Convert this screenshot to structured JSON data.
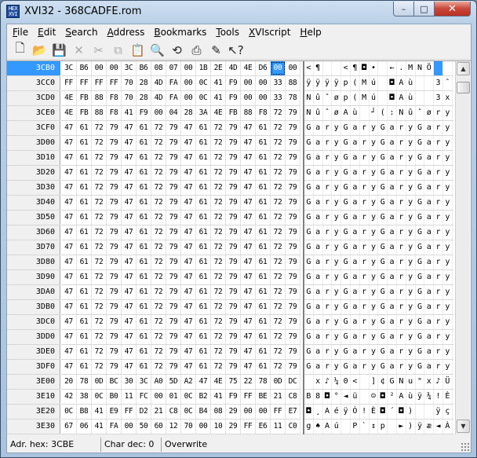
{
  "window": {
    "title": "XVI32 - 368CADFE.rom",
    "icon": "app-hex-icon"
  },
  "controls": {
    "minimize": "–",
    "maximize": "□",
    "close": "✕"
  },
  "menu": [
    {
      "label": "File",
      "u": "F",
      "rest": "ile"
    },
    {
      "label": "Edit",
      "u": "E",
      "rest": "dit"
    },
    {
      "label": "Search",
      "u": "S",
      "rest": "earch"
    },
    {
      "label": "Address",
      "u": "A",
      "rest": "ddress"
    },
    {
      "label": "Bookmarks",
      "u": "B",
      "rest": "ookmarks"
    },
    {
      "label": "Tools",
      "u": "T",
      "rest": "ools"
    },
    {
      "label": "XVIscript",
      "u": "X",
      "rest": "VIscript"
    },
    {
      "label": "Help",
      "u": "H",
      "rest": "elp"
    }
  ],
  "toolbar": [
    {
      "name": "new-file-icon",
      "glyph": "🗋",
      "dim": false
    },
    {
      "name": "open-folder-icon",
      "glyph": "📂",
      "dim": false
    },
    {
      "name": "save-disk-icon",
      "glyph": "💾",
      "dim": false
    },
    {
      "name": "delete-x-icon",
      "glyph": "✕",
      "dim": true
    },
    {
      "name": "cut-scissors-icon",
      "glyph": "✂",
      "dim": true
    },
    {
      "name": "copy-icon",
      "glyph": "⧉",
      "dim": true
    },
    {
      "name": "paste-clipboard-icon",
      "glyph": "📋",
      "dim": false
    },
    {
      "name": "find-magnifier-icon",
      "glyph": "🔍",
      "dim": false
    },
    {
      "name": "replace-icon",
      "glyph": "⟲",
      "dim": false
    },
    {
      "name": "print-icon",
      "glyph": "⎙",
      "dim": false
    },
    {
      "name": "script-pen-icon",
      "glyph": "✎",
      "dim": false
    },
    {
      "name": "context-help-icon",
      "glyph": "↖?",
      "dim": false
    }
  ],
  "selection": {
    "row": 0,
    "col": 14
  },
  "rows": [
    {
      "addr": "3CB0",
      "hex": [
        "3C",
        "B6",
        "00",
        "00",
        "3C",
        "B6",
        "08",
        "07",
        "00",
        "1B",
        "2E",
        "4D",
        "4E",
        "D6",
        "00",
        "00"
      ],
      "text": [
        "<",
        "¶",
        " ",
        " ",
        "<",
        "¶",
        "◘",
        "•",
        " ",
        "←",
        ".",
        "M",
        "N",
        "Ö",
        " ",
        " "
      ]
    },
    {
      "addr": "3CC0",
      "hex": [
        "FF",
        "FF",
        "FF",
        "FF",
        "70",
        "28",
        "4D",
        "FA",
        "00",
        "0C",
        "41",
        "F9",
        "00",
        "00",
        "33",
        "88"
      ],
      "text": [
        "ÿ",
        "ÿ",
        "ÿ",
        "ÿ",
        "p",
        "(",
        "M",
        "ú",
        " ",
        "◘",
        "A",
        "ù",
        " ",
        " ",
        "3",
        "ˆ"
      ]
    },
    {
      "addr": "3CD0",
      "hex": [
        "4E",
        "FB",
        "88",
        "F8",
        "70",
        "28",
        "4D",
        "FA",
        "00",
        "0C",
        "41",
        "F9",
        "00",
        "00",
        "33",
        "78"
      ],
      "text": [
        "N",
        "û",
        "ˆ",
        "ø",
        "p",
        "(",
        "M",
        "ú",
        " ",
        "◘",
        "A",
        "ù",
        " ",
        " ",
        "3",
        "x"
      ]
    },
    {
      "addr": "3CE0",
      "hex": [
        "4E",
        "FB",
        "88",
        "F8",
        "41",
        "F9",
        "00",
        "04",
        "28",
        "3A",
        "4E",
        "FB",
        "88",
        "F8",
        "72",
        "79"
      ],
      "text": [
        "N",
        "û",
        "ˆ",
        "ø",
        "A",
        "ù",
        " ",
        "┘",
        "(",
        ":",
        "N",
        "û",
        "ˆ",
        "ø",
        "r",
        "y"
      ]
    },
    {
      "addr": "3CF0",
      "hex": [
        "47",
        "61",
        "72",
        "79",
        "47",
        "61",
        "72",
        "79",
        "47",
        "61",
        "72",
        "79",
        "47",
        "61",
        "72",
        "79"
      ],
      "text": [
        "G",
        "a",
        "r",
        "y",
        "G",
        "a",
        "r",
        "y",
        "G",
        "a",
        "r",
        "y",
        "G",
        "a",
        "r",
        "y"
      ]
    },
    {
      "addr": "3D00",
      "hex": [
        "47",
        "61",
        "72",
        "79",
        "47",
        "61",
        "72",
        "79",
        "47",
        "61",
        "72",
        "79",
        "47",
        "61",
        "72",
        "79"
      ],
      "text": [
        "G",
        "a",
        "r",
        "y",
        "G",
        "a",
        "r",
        "y",
        "G",
        "a",
        "r",
        "y",
        "G",
        "a",
        "r",
        "y"
      ]
    },
    {
      "addr": "3D10",
      "hex": [
        "47",
        "61",
        "72",
        "79",
        "47",
        "61",
        "72",
        "79",
        "47",
        "61",
        "72",
        "79",
        "47",
        "61",
        "72",
        "79"
      ],
      "text": [
        "G",
        "a",
        "r",
        "y",
        "G",
        "a",
        "r",
        "y",
        "G",
        "a",
        "r",
        "y",
        "G",
        "a",
        "r",
        "y"
      ]
    },
    {
      "addr": "3D20",
      "hex": [
        "47",
        "61",
        "72",
        "79",
        "47",
        "61",
        "72",
        "79",
        "47",
        "61",
        "72",
        "79",
        "47",
        "61",
        "72",
        "79"
      ],
      "text": [
        "G",
        "a",
        "r",
        "y",
        "G",
        "a",
        "r",
        "y",
        "G",
        "a",
        "r",
        "y",
        "G",
        "a",
        "r",
        "y"
      ]
    },
    {
      "addr": "3D30",
      "hex": [
        "47",
        "61",
        "72",
        "79",
        "47",
        "61",
        "72",
        "79",
        "47",
        "61",
        "72",
        "79",
        "47",
        "61",
        "72",
        "79"
      ],
      "text": [
        "G",
        "a",
        "r",
        "y",
        "G",
        "a",
        "r",
        "y",
        "G",
        "a",
        "r",
        "y",
        "G",
        "a",
        "r",
        "y"
      ]
    },
    {
      "addr": "3D40",
      "hex": [
        "47",
        "61",
        "72",
        "79",
        "47",
        "61",
        "72",
        "79",
        "47",
        "61",
        "72",
        "79",
        "47",
        "61",
        "72",
        "79"
      ],
      "text": [
        "G",
        "a",
        "r",
        "y",
        "G",
        "a",
        "r",
        "y",
        "G",
        "a",
        "r",
        "y",
        "G",
        "a",
        "r",
        "y"
      ]
    },
    {
      "addr": "3D50",
      "hex": [
        "47",
        "61",
        "72",
        "79",
        "47",
        "61",
        "72",
        "79",
        "47",
        "61",
        "72",
        "79",
        "47",
        "61",
        "72",
        "79"
      ],
      "text": [
        "G",
        "a",
        "r",
        "y",
        "G",
        "a",
        "r",
        "y",
        "G",
        "a",
        "r",
        "y",
        "G",
        "a",
        "r",
        "y"
      ]
    },
    {
      "addr": "3D60",
      "hex": [
        "47",
        "61",
        "72",
        "79",
        "47",
        "61",
        "72",
        "79",
        "47",
        "61",
        "72",
        "79",
        "47",
        "61",
        "72",
        "79"
      ],
      "text": [
        "G",
        "a",
        "r",
        "y",
        "G",
        "a",
        "r",
        "y",
        "G",
        "a",
        "r",
        "y",
        "G",
        "a",
        "r",
        "y"
      ]
    },
    {
      "addr": "3D70",
      "hex": [
        "47",
        "61",
        "72",
        "79",
        "47",
        "61",
        "72",
        "79",
        "47",
        "61",
        "72",
        "79",
        "47",
        "61",
        "72",
        "79"
      ],
      "text": [
        "G",
        "a",
        "r",
        "y",
        "G",
        "a",
        "r",
        "y",
        "G",
        "a",
        "r",
        "y",
        "G",
        "a",
        "r",
        "y"
      ]
    },
    {
      "addr": "3D80",
      "hex": [
        "47",
        "61",
        "72",
        "79",
        "47",
        "61",
        "72",
        "79",
        "47",
        "61",
        "72",
        "79",
        "47",
        "61",
        "72",
        "79"
      ],
      "text": [
        "G",
        "a",
        "r",
        "y",
        "G",
        "a",
        "r",
        "y",
        "G",
        "a",
        "r",
        "y",
        "G",
        "a",
        "r",
        "y"
      ]
    },
    {
      "addr": "3D90",
      "hex": [
        "47",
        "61",
        "72",
        "79",
        "47",
        "61",
        "72",
        "79",
        "47",
        "61",
        "72",
        "79",
        "47",
        "61",
        "72",
        "79"
      ],
      "text": [
        "G",
        "a",
        "r",
        "y",
        "G",
        "a",
        "r",
        "y",
        "G",
        "a",
        "r",
        "y",
        "G",
        "a",
        "r",
        "y"
      ]
    },
    {
      "addr": "3DA0",
      "hex": [
        "47",
        "61",
        "72",
        "79",
        "47",
        "61",
        "72",
        "79",
        "47",
        "61",
        "72",
        "79",
        "47",
        "61",
        "72",
        "79"
      ],
      "text": [
        "G",
        "a",
        "r",
        "y",
        "G",
        "a",
        "r",
        "y",
        "G",
        "a",
        "r",
        "y",
        "G",
        "a",
        "r",
        "y"
      ]
    },
    {
      "addr": "3DB0",
      "hex": [
        "47",
        "61",
        "72",
        "79",
        "47",
        "61",
        "72",
        "79",
        "47",
        "61",
        "72",
        "79",
        "47",
        "61",
        "72",
        "79"
      ],
      "text": [
        "G",
        "a",
        "r",
        "y",
        "G",
        "a",
        "r",
        "y",
        "G",
        "a",
        "r",
        "y",
        "G",
        "a",
        "r",
        "y"
      ]
    },
    {
      "addr": "3DC0",
      "hex": [
        "47",
        "61",
        "72",
        "79",
        "47",
        "61",
        "72",
        "79",
        "47",
        "61",
        "72",
        "79",
        "47",
        "61",
        "72",
        "79"
      ],
      "text": [
        "G",
        "a",
        "r",
        "y",
        "G",
        "a",
        "r",
        "y",
        "G",
        "a",
        "r",
        "y",
        "G",
        "a",
        "r",
        "y"
      ]
    },
    {
      "addr": "3DD0",
      "hex": [
        "47",
        "61",
        "72",
        "79",
        "47",
        "61",
        "72",
        "79",
        "47",
        "61",
        "72",
        "79",
        "47",
        "61",
        "72",
        "79"
      ],
      "text": [
        "G",
        "a",
        "r",
        "y",
        "G",
        "a",
        "r",
        "y",
        "G",
        "a",
        "r",
        "y",
        "G",
        "a",
        "r",
        "y"
      ]
    },
    {
      "addr": "3DE0",
      "hex": [
        "47",
        "61",
        "72",
        "79",
        "47",
        "61",
        "72",
        "79",
        "47",
        "61",
        "72",
        "79",
        "47",
        "61",
        "72",
        "79"
      ],
      "text": [
        "G",
        "a",
        "r",
        "y",
        "G",
        "a",
        "r",
        "y",
        "G",
        "a",
        "r",
        "y",
        "G",
        "a",
        "r",
        "y"
      ]
    },
    {
      "addr": "3DF0",
      "hex": [
        "47",
        "61",
        "72",
        "79",
        "47",
        "61",
        "72",
        "79",
        "47",
        "61",
        "72",
        "79",
        "47",
        "61",
        "72",
        "79"
      ],
      "text": [
        "G",
        "a",
        "r",
        "y",
        "G",
        "a",
        "r",
        "y",
        "G",
        "a",
        "r",
        "y",
        "G",
        "a",
        "r",
        "y"
      ]
    },
    {
      "addr": "3E00",
      "hex": [
        "20",
        "78",
        "0D",
        "BC",
        "30",
        "3C",
        "A0",
        "5D",
        "A2",
        "47",
        "4E",
        "75",
        "22",
        "78",
        "0D",
        "DC"
      ],
      "text": [
        " ",
        "x",
        "♪",
        "¼",
        "0",
        "<",
        " ",
        "]",
        "¢",
        "G",
        "N",
        "u",
        "\"",
        "x",
        "♪",
        "Ü"
      ]
    },
    {
      "addr": "3E10",
      "hex": [
        "42",
        "38",
        "0C",
        "B0",
        "11",
        "FC",
        "00",
        "01",
        "0C",
        "B2",
        "41",
        "F9",
        "FF",
        "BE",
        "21",
        "C8"
      ],
      "text": [
        "B",
        "8",
        "◘",
        "°",
        "◄",
        "ü",
        " ",
        "☺",
        "◘",
        "²",
        "A",
        "ù",
        "ÿ",
        "¾",
        "!",
        "È"
      ]
    },
    {
      "addr": "3E20",
      "hex": [
        "0C",
        "B8",
        "41",
        "E9",
        "FF",
        "D2",
        "21",
        "C8",
        "0C",
        "B4",
        "08",
        "29",
        "00",
        "00",
        "FF",
        "E7"
      ],
      "text": [
        "◘",
        "¸",
        "A",
        "é",
        "ÿ",
        "Ò",
        "!",
        "È",
        "◘",
        "´",
        "◘",
        ")",
        " ",
        " ",
        "ÿ",
        "ç"
      ]
    },
    {
      "addr": "3E30",
      "hex": [
        "67",
        "06",
        "41",
        "FA",
        "00",
        "50",
        "60",
        "12",
        "70",
        "00",
        "10",
        "29",
        "FF",
        "E6",
        "11",
        "C0"
      ],
      "text": [
        "g",
        "♠",
        "A",
        "ú",
        " ",
        "P",
        "`",
        "↕",
        "p",
        " ",
        "►",
        ")",
        "ÿ",
        "æ",
        "◄",
        "À"
      ]
    }
  ],
  "scrollbar": {
    "up": "▲",
    "down": "▼"
  },
  "status": {
    "addr": "Adr. hex: 3CBE",
    "char": "Char dec: 0",
    "mode": "Overwrite"
  }
}
